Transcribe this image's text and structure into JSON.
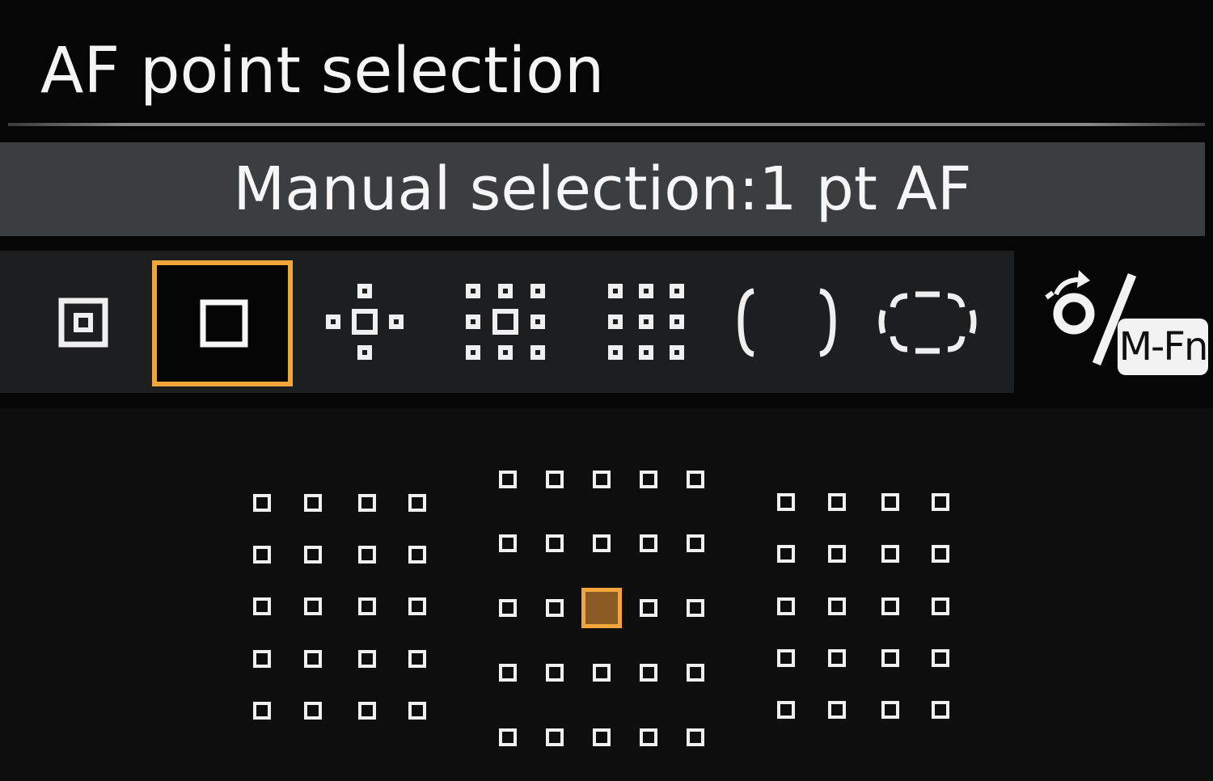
{
  "header": {
    "title": "AF point selection"
  },
  "mode": {
    "label": "Manual selection:1 pt AF"
  },
  "mode_options": [
    {
      "id": "spot-af",
      "icon": "spot-af-icon"
    },
    {
      "id": "1-pt-af",
      "icon": "single-point-af-icon",
      "selected": true
    },
    {
      "id": "expand-cross",
      "icon": "expand-af-cross-icon"
    },
    {
      "id": "expand-surround",
      "icon": "expand-af-surround-icon"
    },
    {
      "id": "zone-af",
      "icon": "zone-af-icon"
    },
    {
      "id": "large-zone-vertical",
      "icon": "large-zone-vertical-icon"
    },
    {
      "id": "large-zone-horizontal",
      "icon": "large-zone-horizontal-icon"
    }
  ],
  "switch_control": {
    "icon": "dial-switch-icon",
    "badge": "M-Fn"
  },
  "af_grid": {
    "groups": [
      {
        "name": "left",
        "columns": 4,
        "rows": 5
      },
      {
        "name": "center",
        "columns": 5,
        "rows": 5
      },
      {
        "name": "right",
        "columns": 4,
        "rows": 5
      }
    ],
    "selected_point": {
      "group": "center",
      "column": 3,
      "row": 3
    }
  },
  "colors": {
    "accent": "#f0a63a",
    "selected_fill": "#8a5b22",
    "banner": "#3c3d3f",
    "mode_bar": "#1d1e20"
  }
}
